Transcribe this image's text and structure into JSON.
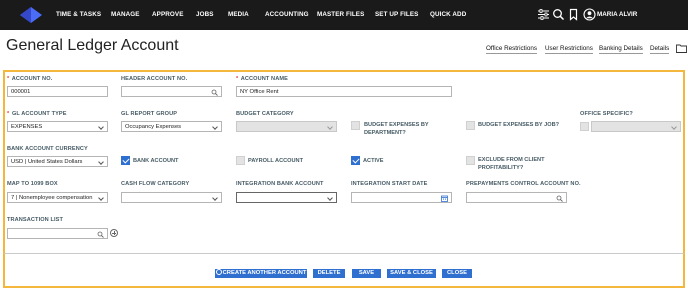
{
  "nav": {
    "items": [
      "TIME & TASKS",
      "MANAGE",
      "APPROVE",
      "JOBS",
      "MEDIA",
      "ACCOUNTING",
      "MASTER FILES",
      "SET UP FILES",
      "QUICK ADD"
    ],
    "user_name": "MARIA ALVIR"
  },
  "page": {
    "title": "General Ledger Account",
    "links": [
      "Office Restrictions",
      "User Restrictions",
      "Banking Details",
      "Details"
    ]
  },
  "form": {
    "account_no": {
      "label": "ACCOUNT NO.",
      "value": "000001"
    },
    "header_account_no": {
      "label": "HEADER ACCOUNT NO.",
      "value": ""
    },
    "account_name": {
      "label": "ACCOUNT NAME",
      "value": "NY Office Rent"
    },
    "gl_account_type": {
      "label": "GL ACCOUNT TYPE",
      "value": "EXPENSES"
    },
    "gl_report_group": {
      "label": "GL REPORT GROUP",
      "value": "Occupancy Expenses"
    },
    "budget_category": {
      "label": "BUDGET CATEGORY",
      "value": ""
    },
    "budget_by_department": {
      "label_line1": "BUDGET EXPENSES BY",
      "label_line2": "DEPARTMENT?",
      "checked": false
    },
    "budget_by_job": {
      "label": "BUDGET EXPENSES BY JOB?",
      "checked": false
    },
    "office_specific": {
      "label": "OFFICE SPECIFIC?",
      "checked": false
    },
    "bank_account_currency": {
      "label": "BANK ACCOUNT CURRENCY",
      "value": "USD | United States Dollars"
    },
    "bank_account": {
      "label": "BANK ACCOUNT",
      "checked": true
    },
    "payroll_account": {
      "label": "PAYROLL ACCOUNT",
      "checked": false
    },
    "active": {
      "label": "ACTIVE",
      "checked": true
    },
    "exclude_profitability": {
      "label_line1": "EXCLUDE FROM CLIENT",
      "label_line2": "PROFITABILITY?",
      "checked": false
    },
    "map_to_1099": {
      "label": "MAP TO 1099 BOX",
      "value": "7 | Nonemployee compensation"
    },
    "cash_flow_category": {
      "label": "CASH FLOW CATEGORY",
      "value": ""
    },
    "integration_bank_account": {
      "label": "INTEGRATION BANK ACCOUNT",
      "value": ""
    },
    "integration_start_date": {
      "label": "INTEGRATION START DATE",
      "value": ""
    },
    "prepayments_control": {
      "label": "PREPAYMENTS CONTROL ACCOUNT NO.",
      "value": ""
    },
    "transaction_list": {
      "label": "TRANSACTION LIST",
      "value": ""
    }
  },
  "buttons": {
    "create_another": "CREATE ANOTHER ACCOUNT",
    "delete": "DELETE",
    "save": "SAVE",
    "save_close": "SAVE & CLOSE",
    "close": "CLOSE"
  },
  "colors": {
    "accent": "#2f6fd0",
    "highlight": "#f4b73d",
    "topbar": "#1a1a1a",
    "logo": "#4a6cf7"
  }
}
